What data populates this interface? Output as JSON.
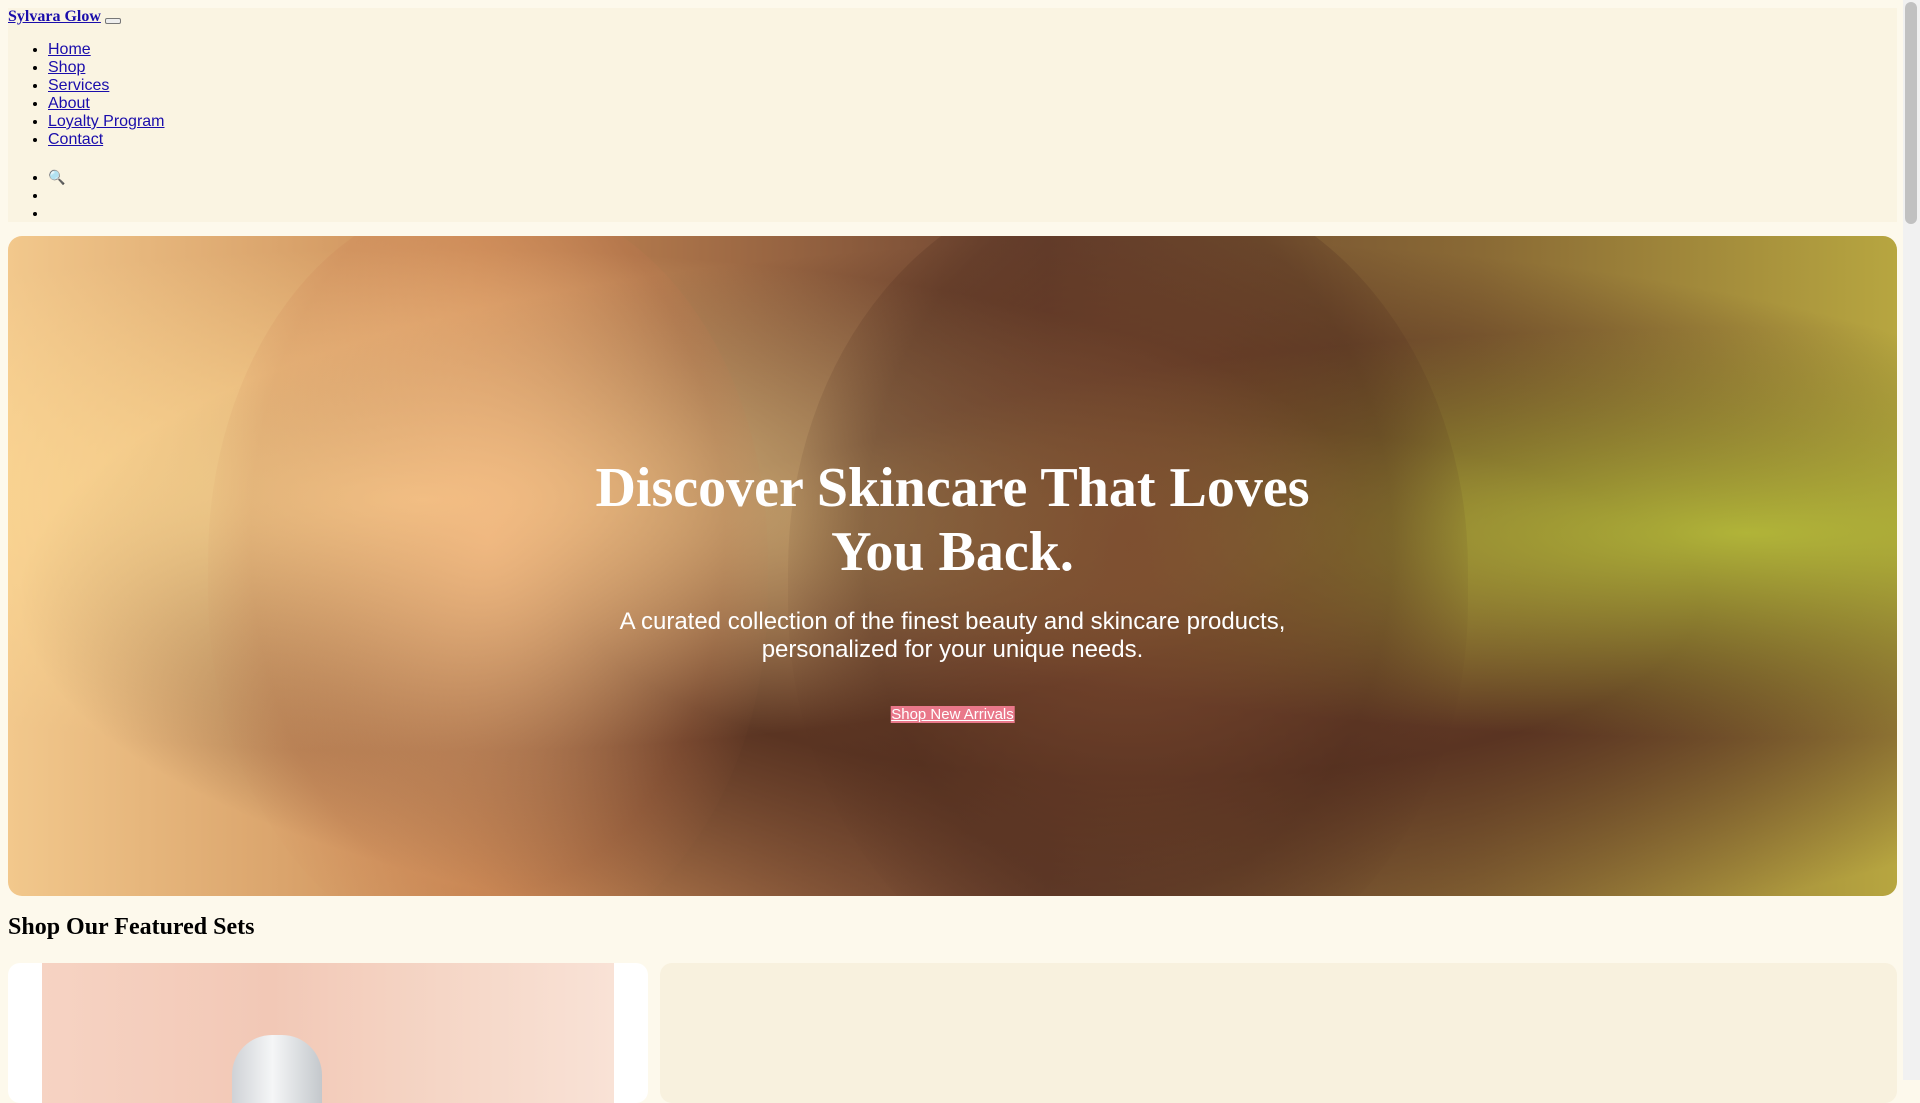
{
  "header": {
    "brand": "Sylvara Glow",
    "nav": [
      "Home",
      "Shop",
      "Services",
      "About",
      "Loyalty Program",
      "Contact"
    ],
    "icons": [
      {
        "name": "search-icon",
        "glyph": "🔍"
      },
      {
        "name": "user-icon",
        "glyph": ""
      },
      {
        "name": "cart-icon",
        "glyph": ""
      }
    ]
  },
  "hero": {
    "title": "Discover Skincare That Loves You Back.",
    "subtitle": "A curated collection of the finest beauty and skincare products, personalized for your unique needs.",
    "cta": "Shop New Arrivals"
  },
  "featured": {
    "title": "Shop Our Featured Sets"
  },
  "colors": {
    "link": "#1a0dab",
    "background": "#fdf9ec",
    "cta_bg": "#e9788a"
  }
}
